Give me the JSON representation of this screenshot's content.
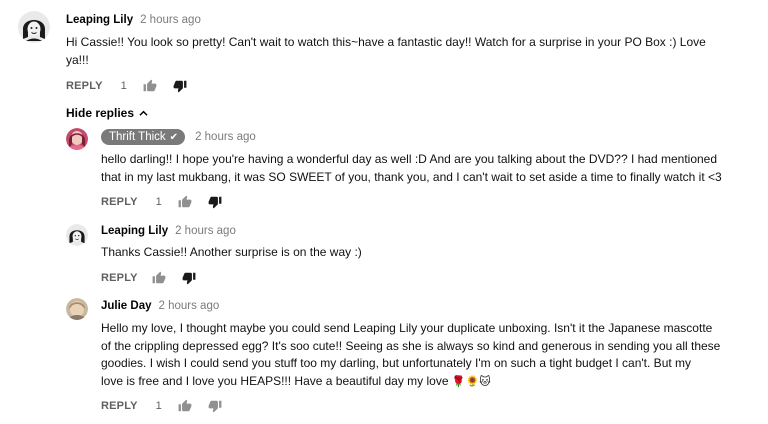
{
  "comments": [
    {
      "author": "Leaping Lily",
      "time": "2 hours ago",
      "text": "Hi Cassie!! You look so pretty! Can't wait to watch this~have a fantastic day!! Watch for a surprise in your PO Box :) Love\nya!!!",
      "reply_label": "REPLY",
      "likes": "1"
    }
  ],
  "hide_replies_label": "Hide replies",
  "replies": [
    {
      "author": "Thrift Thick",
      "verified_icon": "check-icon",
      "time": "2 hours ago",
      "text": "hello darling!! I hope you're having a wonderful day as well :D And are you talking about the DVD?? I had mentioned\nthat in my last mukbang, it was SO SWEET of you, thank you, and I can't wait to set aside a time to finally watch it <3",
      "reply_label": "REPLY",
      "likes": "1"
    },
    {
      "author": "Leaping Lily",
      "time": "2 hours ago",
      "text": "Thanks Cassie!! Another surprise is on the way :)",
      "reply_label": "REPLY",
      "likes": ""
    },
    {
      "author": "Julie Day",
      "time": "2 hours ago",
      "text": "Hello my love, I thought maybe you could send Leaping Lily your duplicate unboxing. Isn't it the Japanese mascotte\nof the crippling depressed egg? It's soo cute!! Seeing as she is always so kind and generous in sending you all these\ngoodies. I wish I could send you stuff too my darling, but unfortunately I'm on such a tight budget I can't. But my\nlove is free and I love you HEAPS!!! Have a beautiful day my love",
      "emojis": "🌹🌻🐱",
      "reply_label": "REPLY",
      "likes": "1"
    }
  ],
  "colors": {
    "meta_gray": "#7b7b7b",
    "action_gray": "#606060",
    "badge_bg": "#7a7a7a"
  }
}
